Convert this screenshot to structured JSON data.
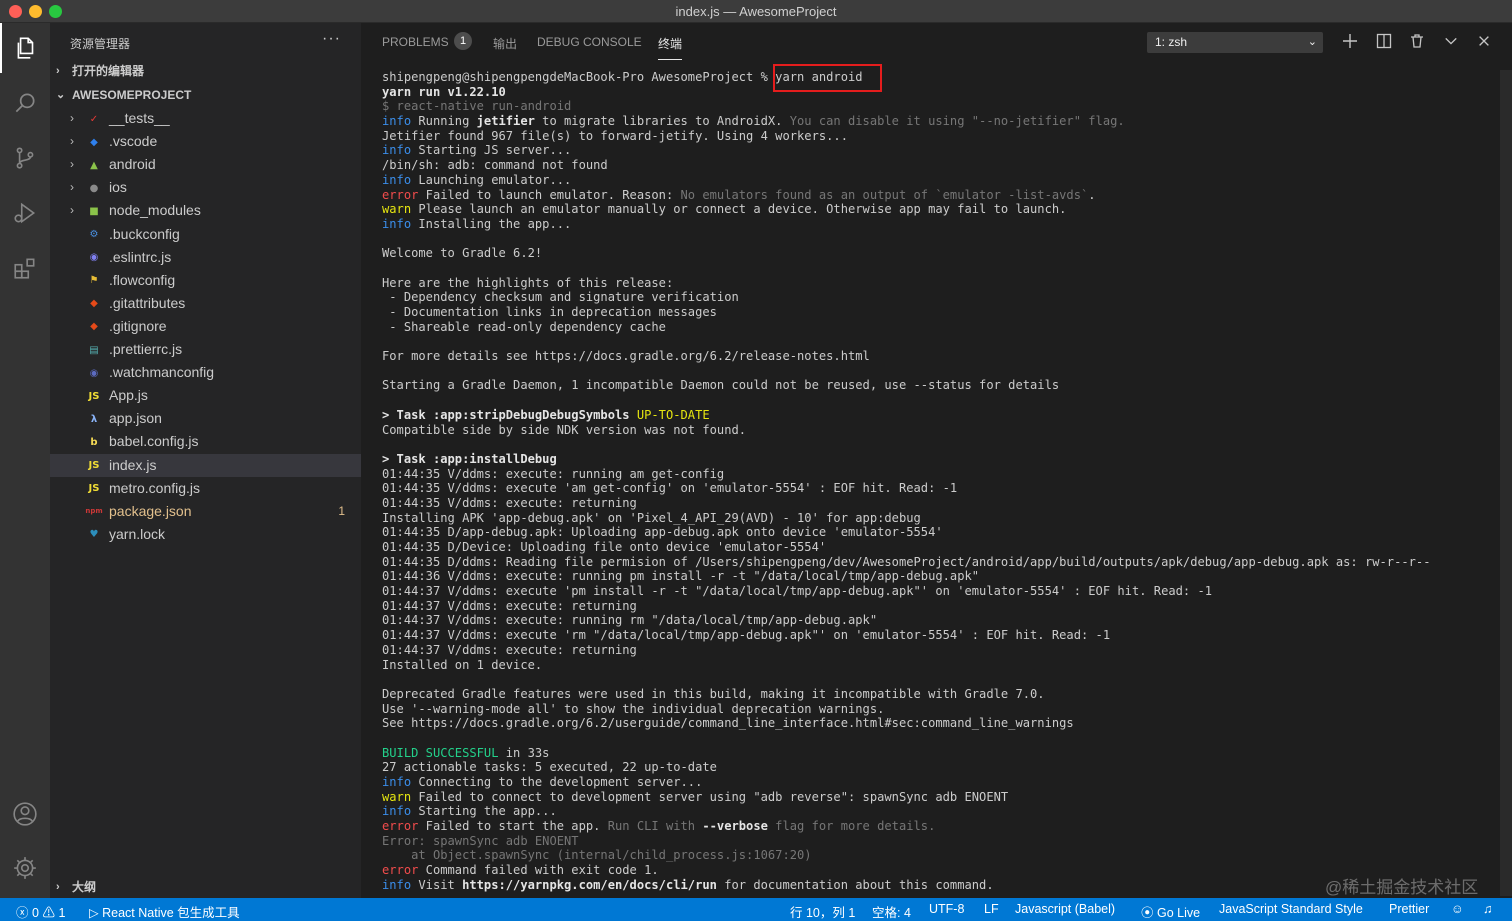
{
  "window": {
    "title": "index.js — AwesomeProject"
  },
  "sidebar": {
    "header": "资源管理器",
    "more": "···",
    "open_editors": "打开的编辑器",
    "project": "AWESOMEPROJECT",
    "outline": "大纲",
    "items": [
      {
        "label": "__tests__",
        "folder": true,
        "icon": "tests-folder-icon",
        "color": "#e53935",
        "glyph": "✓"
      },
      {
        "label": ".vscode",
        "folder": true,
        "icon": "vscode-folder-icon",
        "color": "#2f80ed",
        "glyph": "◆"
      },
      {
        "label": "android",
        "folder": true,
        "icon": "android-folder-icon",
        "color": "#8bc34a",
        "glyph": "▲"
      },
      {
        "label": "ios",
        "folder": true,
        "icon": "ios-folder-icon",
        "color": "#8a8a8a",
        "glyph": "●"
      },
      {
        "label": "node_modules",
        "folder": true,
        "icon": "node-folder-icon",
        "color": "#8bc34a",
        "glyph": "■"
      },
      {
        "label": ".buckconfig",
        "folder": false,
        "icon": "buck-icon",
        "color": "#4a90e2",
        "glyph": "⚙"
      },
      {
        "label": ".eslintrc.js",
        "folder": false,
        "icon": "eslint-icon",
        "color": "#8080f2",
        "glyph": "◉"
      },
      {
        "label": ".flowconfig",
        "folder": false,
        "icon": "flow-icon",
        "color": "#e8bd36",
        "glyph": "⚑"
      },
      {
        "label": ".gitattributes",
        "folder": false,
        "icon": "git-icon",
        "color": "#e64a19",
        "glyph": "◆"
      },
      {
        "label": ".gitignore",
        "folder": false,
        "icon": "git-icon",
        "color": "#e64a19",
        "glyph": "◆"
      },
      {
        "label": ".prettierrc.js",
        "folder": false,
        "icon": "prettier-icon",
        "color": "#56b3b4",
        "glyph": "▤"
      },
      {
        "label": ".watchmanconfig",
        "folder": false,
        "icon": "watchman-icon",
        "color": "#5c6bc0",
        "glyph": "◉"
      },
      {
        "label": "App.js",
        "folder": false,
        "icon": "js-icon",
        "color": "#f1dd35",
        "glyph": "JS"
      },
      {
        "label": "app.json",
        "folder": false,
        "icon": "json-icon",
        "color": "#8ab4f8",
        "glyph": "λ"
      },
      {
        "label": "babel.config.js",
        "folder": false,
        "icon": "babel-icon",
        "color": "#f5da55",
        "glyph": "b"
      },
      {
        "label": "index.js",
        "folder": false,
        "icon": "js-icon",
        "color": "#f1dd35",
        "glyph": "JS",
        "selected": true
      },
      {
        "label": "metro.config.js",
        "folder": false,
        "icon": "js-icon",
        "color": "#f1dd35",
        "glyph": "JS"
      },
      {
        "label": "package.json",
        "folder": false,
        "icon": "npm-icon",
        "color": "#cb3837",
        "glyph": "npm",
        "modified": true,
        "badge": "1"
      },
      {
        "label": "yarn.lock",
        "folder": false,
        "icon": "yarn-icon",
        "color": "#2c8ebb",
        "glyph": "♥"
      }
    ]
  },
  "panel": {
    "tabs": {
      "problems": "PROBLEMS",
      "problems_count": "1",
      "output": "输出",
      "debug": "DEBUG CONSOLE",
      "terminal": "终端"
    },
    "shell": "1: zsh"
  },
  "terminal": {
    "lines": [
      [
        {
          "t": "shipengpeng@shipengpengdeMacBook-Pro AwesomeProject % yarn android"
        }
      ],
      [
        {
          "t": "yarn run v1.22.10",
          "c": "b"
        }
      ],
      [
        {
          "t": "$ react-native run-android",
          "c": "dim"
        }
      ],
      [
        {
          "t": "info",
          "c": "blue"
        },
        {
          "t": " Running "
        },
        {
          "t": "jetifier",
          "c": "b"
        },
        {
          "t": " to migrate libraries to AndroidX. "
        },
        {
          "t": "You can disable it using \"--no-jetifier\" flag.",
          "c": "dim"
        }
      ],
      [
        {
          "t": "Jetifier found 967 file(s) to forward-jetify. Using 4 workers..."
        }
      ],
      [
        {
          "t": "info",
          "c": "blue"
        },
        {
          "t": " Starting JS server..."
        }
      ],
      [
        {
          "t": "/bin/sh: adb: command not found"
        }
      ],
      [
        {
          "t": "info",
          "c": "blue"
        },
        {
          "t": " Launching emulator..."
        }
      ],
      [
        {
          "t": "error",
          "c": "red"
        },
        {
          "t": " Failed to launch emulator. Reason: "
        },
        {
          "t": "No emulators found as an output of `emulator -list-avds`",
          "c": "dim"
        },
        {
          "t": "."
        }
      ],
      [
        {
          "t": "warn",
          "c": "yel"
        },
        {
          "t": " Please launch an emulator manually or connect a device. Otherwise app may fail to launch."
        }
      ],
      [
        {
          "t": "info",
          "c": "blue"
        },
        {
          "t": " Installing the app..."
        }
      ],
      [
        {
          "t": ""
        }
      ],
      [
        {
          "t": "Welcome to Gradle 6.2!"
        }
      ],
      [
        {
          "t": ""
        }
      ],
      [
        {
          "t": "Here are the highlights of this release:"
        }
      ],
      [
        {
          "t": " - Dependency checksum and signature verification"
        }
      ],
      [
        {
          "t": " - Documentation links in deprecation messages"
        }
      ],
      [
        {
          "t": " - Shareable read-only dependency cache"
        }
      ],
      [
        {
          "t": ""
        }
      ],
      [
        {
          "t": "For more details see https://docs.gradle.org/6.2/release-notes.html"
        }
      ],
      [
        {
          "t": ""
        }
      ],
      [
        {
          "t": "Starting a Gradle Daemon, 1 incompatible Daemon could not be reused, use --status for details"
        }
      ],
      [
        {
          "t": ""
        }
      ],
      [
        {
          "t": "> Task :app:stripDebugDebugSymbols",
          "c": "b"
        },
        {
          "t": " UP-TO-DATE",
          "c": "yel"
        }
      ],
      [
        {
          "t": "Compatible side by side NDK version was not found."
        }
      ],
      [
        {
          "t": ""
        }
      ],
      [
        {
          "t": "> Task :app:installDebug",
          "c": "b"
        }
      ],
      [
        {
          "t": "01:44:35 V/ddms: execute: running am get-config"
        }
      ],
      [
        {
          "t": "01:44:35 V/ddms: execute 'am get-config' on 'emulator-5554' : EOF hit. Read: -1"
        }
      ],
      [
        {
          "t": "01:44:35 V/ddms: execute: returning"
        }
      ],
      [
        {
          "t": "Installing APK 'app-debug.apk' on 'Pixel_4_API_29(AVD) - 10' for app:debug"
        }
      ],
      [
        {
          "t": "01:44:35 D/app-debug.apk: Uploading app-debug.apk onto device 'emulator-5554'"
        }
      ],
      [
        {
          "t": "01:44:35 D/Device: Uploading file onto device 'emulator-5554'"
        }
      ],
      [
        {
          "t": "01:44:35 D/ddms: Reading file permision of /Users/shipengpeng/dev/AwesomeProject/android/app/build/outputs/apk/debug/app-debug.apk as: rw-r--r--"
        }
      ],
      [
        {
          "t": "01:44:36 V/ddms: execute: running pm install -r -t \"/data/local/tmp/app-debug.apk\""
        }
      ],
      [
        {
          "t": "01:44:37 V/ddms: execute 'pm install -r -t \"/data/local/tmp/app-debug.apk\"' on 'emulator-5554' : EOF hit. Read: -1"
        }
      ],
      [
        {
          "t": "01:44:37 V/ddms: execute: returning"
        }
      ],
      [
        {
          "t": "01:44:37 V/ddms: execute: running rm \"/data/local/tmp/app-debug.apk\""
        }
      ],
      [
        {
          "t": "01:44:37 V/ddms: execute 'rm \"/data/local/tmp/app-debug.apk\"' on 'emulator-5554' : EOF hit. Read: -1"
        }
      ],
      [
        {
          "t": "01:44:37 V/ddms: execute: returning"
        }
      ],
      [
        {
          "t": "Installed on 1 device."
        }
      ],
      [
        {
          "t": ""
        }
      ],
      [
        {
          "t": "Deprecated Gradle features were used in this build, making it incompatible with Gradle 7.0."
        }
      ],
      [
        {
          "t": "Use '--warning-mode all' to show the individual deprecation warnings."
        }
      ],
      [
        {
          "t": "See https://docs.gradle.org/6.2/userguide/command_line_interface.html#sec:command_line_warnings"
        }
      ],
      [
        {
          "t": ""
        }
      ],
      [
        {
          "t": "BUILD SUCCESSFUL",
          "c": "grn"
        },
        {
          "t": " in 33s"
        }
      ],
      [
        {
          "t": "27 actionable tasks: 5 executed, 22 up-to-date"
        }
      ],
      [
        {
          "t": "info",
          "c": "blue"
        },
        {
          "t": " Connecting to the development server..."
        }
      ],
      [
        {
          "t": "warn",
          "c": "yel"
        },
        {
          "t": " Failed to connect to development server using \"adb reverse\": spawnSync adb ENOENT"
        }
      ],
      [
        {
          "t": "info",
          "c": "blue"
        },
        {
          "t": " Starting the app..."
        }
      ],
      [
        {
          "t": "error",
          "c": "red"
        },
        {
          "t": " Failed to start the app. "
        },
        {
          "t": "Run CLI with ",
          "c": "dim"
        },
        {
          "t": "--verbose",
          "c": "b"
        },
        {
          "t": " flag for more details.",
          "c": "dim"
        }
      ],
      [
        {
          "t": "Error: spawnSync adb ENOENT",
          "c": "dim"
        }
      ],
      [
        {
          "t": "    at Object.spawnSync (internal/child_process.js:1067:20)",
          "c": "dim"
        }
      ],
      [
        {
          "t": "error",
          "c": "red"
        },
        {
          "t": " Command failed with exit code 1."
        }
      ],
      [
        {
          "t": "info",
          "c": "blue"
        },
        {
          "t": " Visit "
        },
        {
          "t": "https://yarnpkg.com/en/docs/cli/run",
          "c": "b"
        },
        {
          "t": " for documentation about this command."
        }
      ]
    ]
  },
  "statusbar": {
    "errors": "0",
    "warnings": "1",
    "task": "React Native 包生成工具",
    "position": "行 10，列 1",
    "spaces": "空格: 4",
    "encoding": "UTF-8",
    "eol": "LF",
    "language": "Javascript (Babel)",
    "golive": "Go Live",
    "linter": "JavaScript Standard Style",
    "formatter": "Prettier"
  },
  "watermark": "@稀土掘金技术社区"
}
